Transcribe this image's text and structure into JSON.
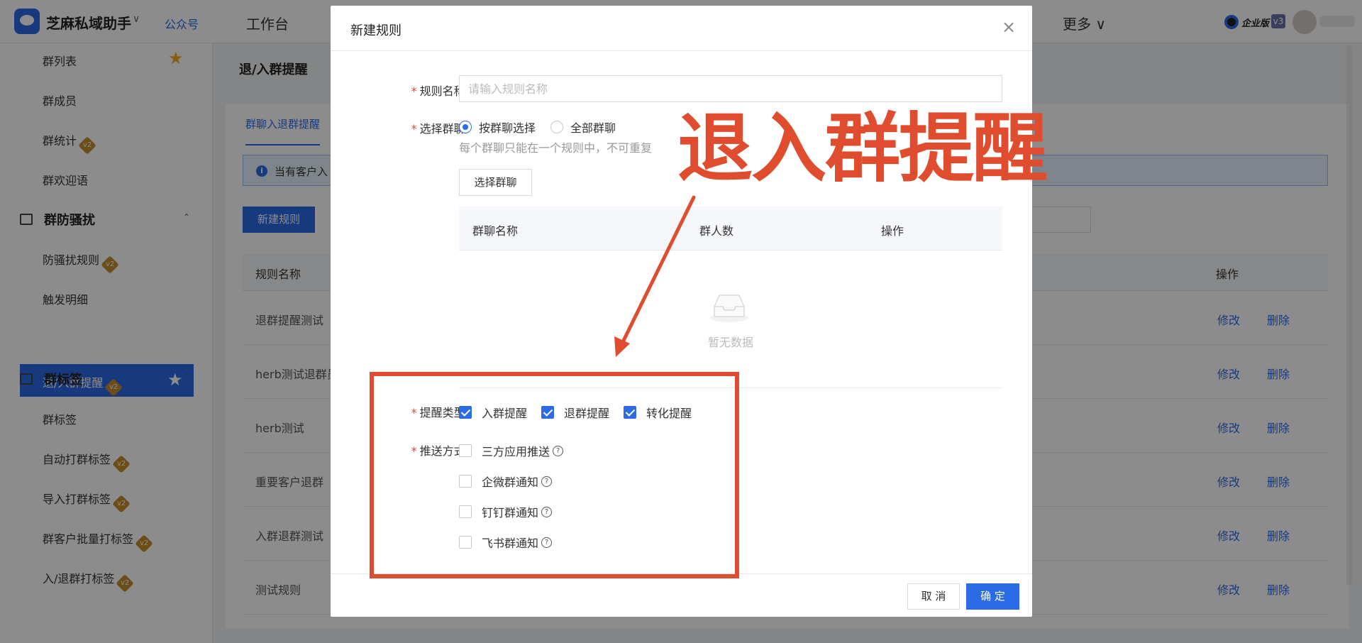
{
  "header": {
    "app_name": "芝麻私域助手",
    "app_caret": "∨",
    "official_account": "公众号",
    "nav_workbench": "工作台",
    "nav_more": "更多 ∨",
    "enterprise_label": "企业版",
    "version_badge": "v3"
  },
  "sidebar": {
    "items_top": [
      {
        "label": "群列表",
        "starred": true
      },
      {
        "label": "群成员"
      },
      {
        "label": "群统计",
        "badge": "v2"
      },
      {
        "label": "群欢迎语"
      }
    ],
    "group_anti_harass": {
      "label": "群防骚扰",
      "chevron": "⌃"
    },
    "anti_items": [
      {
        "label": "防骚扰规则",
        "badge": "v2"
      },
      {
        "label": "触发明细"
      }
    ],
    "active_item": {
      "label": "退/入群提醒",
      "badge": "v2"
    },
    "group_tags": {
      "label": "群标签",
      "chevron": "⌃"
    },
    "tag_items": [
      {
        "label": "群标签"
      },
      {
        "label": "自动打群标签",
        "badge": "v2"
      },
      {
        "label": "导入打群标签",
        "badge": "v2"
      },
      {
        "label": "群客户批量打标签",
        "badge": "v2"
      },
      {
        "label": "入/退群打标签",
        "badge": "v2"
      }
    ],
    "badge_text": "v2"
  },
  "page": {
    "title": "退/入群提醒",
    "tab_active": "群聊入退群提醒",
    "notice_icon": "i",
    "notice_text": "当有客户入",
    "new_rule_button": "新建规则",
    "table_header_name": "规则名称",
    "table_header_op": "操作",
    "rows": [
      {
        "name": "退群提醒测试",
        "edit": "修改",
        "delete": "删除"
      },
      {
        "name": "herb测试退群员",
        "edit": "修改",
        "delete": "删除"
      },
      {
        "name": "herb测试",
        "edit": "修改",
        "delete": "删除"
      },
      {
        "name": "重要客户退群",
        "edit": "修改",
        "delete": "删除"
      },
      {
        "name": "入群退群测试",
        "edit": "修改",
        "delete": "删除"
      },
      {
        "name": "测试规则",
        "edit": "修改",
        "delete": "删除"
      }
    ]
  },
  "modal": {
    "title": "新建规则",
    "close_glyph": "×",
    "rule_name_label": "规则名称:",
    "rule_name_placeholder": "请输入规则名称",
    "rule_name_value": "",
    "select_group_label": "选择群聊:",
    "radio_by_group": "按群聊选择",
    "radio_all_groups": "全部群聊",
    "radio_selected": "按群聊选择",
    "hint": "每个群聊只能在一个规则中，不可重复",
    "select_group_button": "选择群聊",
    "inner_table": {
      "col_name": "群聊名称",
      "col_count": "群人数",
      "col_op": "操作"
    },
    "empty_text": "暂无数据",
    "remind_type_label": "提醒类型:",
    "remind_types": [
      {
        "label": "入群提醒",
        "checked": true
      },
      {
        "label": "退群提醒",
        "checked": true
      },
      {
        "label": "转化提醒",
        "checked": true
      }
    ],
    "push_method_label": "推送方式:",
    "push_methods": [
      {
        "label": "三方应用推送",
        "checked": false
      },
      {
        "label": "企微群通知",
        "checked": false
      },
      {
        "label": "钉钉群通知",
        "checked": false
      },
      {
        "label": "飞书群通知",
        "checked": false
      }
    ],
    "help_glyph": "?",
    "required_mark": "*",
    "cancel_button": "取 消",
    "ok_button": "确 定"
  },
  "annotation": {
    "text": "退入群提醒",
    "color": "#e04c2e"
  },
  "colors": {
    "primary": "#2b6be6",
    "annotation_red": "#e04c2e",
    "badge_gold": "#c58a2a",
    "star": "#f5a623"
  }
}
